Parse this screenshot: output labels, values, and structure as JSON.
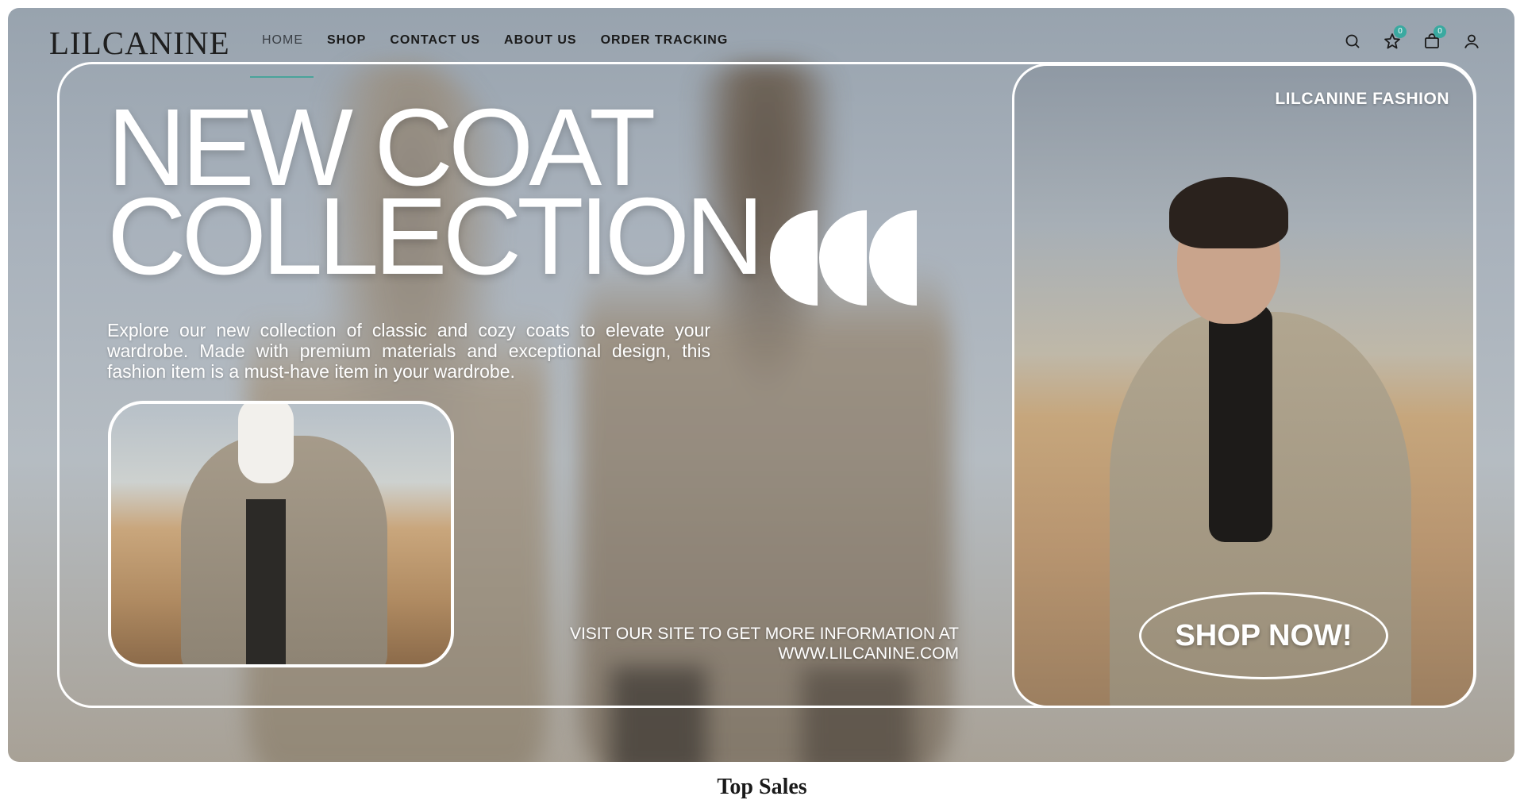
{
  "brand": {
    "logo": "LILCANINE"
  },
  "nav": {
    "items": [
      {
        "label": "HOME",
        "active": true
      },
      {
        "label": "SHOP"
      },
      {
        "label": "CONTACT US"
      },
      {
        "label": "ABOUT US"
      },
      {
        "label": "ORDER TRACKING"
      }
    ]
  },
  "header_icons": {
    "search": "search-icon",
    "wishlist": {
      "icon": "star-icon",
      "count": "0"
    },
    "cart": {
      "icon": "bag-icon",
      "count": "0"
    },
    "account": "user-icon"
  },
  "hero": {
    "headline_line1": "NEW COAT",
    "headline_line2": "COLLECTION",
    "description": "Explore our new collection of classic and cozy coats to elevate your wardrobe. Made with premium materials and exceptional design, this fashion item is a must-have item in your wardrobe.",
    "visit_line1": "VISIT OUR SITE TO GET MORE INFORMATION AT",
    "visit_line2": "WWW.LILCANINE.COM",
    "brand_tag": "LILCANINE FASHION",
    "cta": "SHOP NOW!"
  },
  "section_title": "Top Sales",
  "colors": {
    "accent": "#3aa9a0",
    "text_dark": "#1a1a1a",
    "white": "#ffffff"
  }
}
